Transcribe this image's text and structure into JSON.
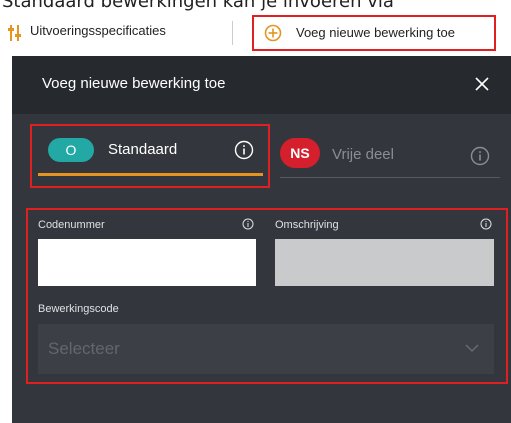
{
  "top_strip": {
    "text": "Standaard bewerkingen kan je invoeren via"
  },
  "toolbar": {
    "left_item_label": "Uitvoeringsspecificaties",
    "right_item_label": "Voeg nieuwe bewerking toe",
    "left_icon": "settings-sliders-icon",
    "right_icon": "plus-circle-icon"
  },
  "dialog": {
    "title": "Voeg nieuwe bewerking toe",
    "close_icon": "close-icon",
    "tabs": [
      {
        "badge": "O",
        "label": "Standaard",
        "active": true,
        "badge_color": "#22a9a6"
      },
      {
        "badge": "NS",
        "label": "Vrije deel",
        "active": false,
        "badge_color": "#d61f2c"
      }
    ],
    "fields": {
      "code": {
        "label": "Codenummer",
        "value": ""
      },
      "description": {
        "label": "Omschrijving",
        "value": ""
      },
      "operation": {
        "label": "Bewerkingscode",
        "placeholder": "Selecteer"
      }
    }
  },
  "colors": {
    "accent_underline": "#e59421",
    "highlight_border": "#e02020",
    "panel_bg": "#33363c",
    "header_bg": "#26292d"
  }
}
